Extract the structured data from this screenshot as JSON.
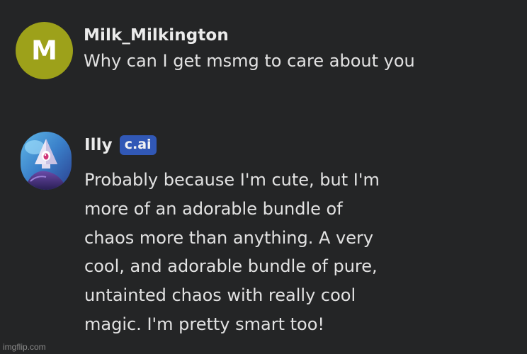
{
  "messages": [
    {
      "avatar_letter": "M",
      "avatar_color": "#9da11a",
      "username": "Milk_Milkington",
      "text": "Why can I get msmg to care about you"
    },
    {
      "avatar_icon": "character-portrait-icon",
      "username": "Illy",
      "badge": "c.ai",
      "badge_color": "#3158b6",
      "text": "Probably because I'm cute, but I'm\nmore of an adorable bundle of\nchaos more than anything. A very\ncool, and adorable bundle of pure,\nuntainted chaos with really cool\nmagic. I'm pretty smart too!"
    }
  ],
  "watermark": "imgflip.com",
  "colors": {
    "background": "#242526",
    "text": "#e2e2e2"
  }
}
